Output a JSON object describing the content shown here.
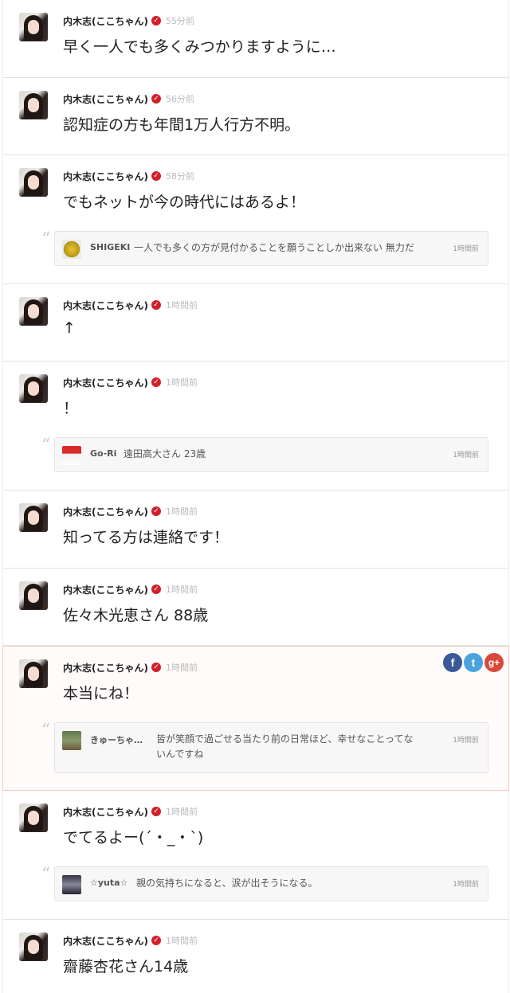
{
  "colors": {
    "accent": "#d21f2b",
    "highlight_border": "#f3c9c2",
    "facebook": "#3b5998",
    "twitter": "#4aa3df",
    "google": "#d8493b"
  },
  "posts": [
    {
      "name": "内木志(ここちゃん)",
      "time": "55分前",
      "text": "早く一人でも多くみつかりますように…"
    },
    {
      "name": "内木志(ここちゃん)",
      "time": "56分前",
      "text": "認知症の方も年間1万人行方不明。"
    },
    {
      "name": "内木志(ここちゃん)",
      "time": "58分前",
      "text": "でもネットが今の時代にはあるよ！",
      "quote": {
        "user": "SHIGEKI",
        "text": "一人でも多くの方が見付かることを願うことしか出来ない 無力だ",
        "time": "1時間前"
      }
    },
    {
      "name": "内木志(ここちゃん)",
      "time": "1時間前",
      "text": "↑"
    },
    {
      "name": "内木志(ここちゃん)",
      "time": "1時間前",
      "text": "！",
      "quote": {
        "user": "Go-Ri",
        "text": "遠田高大さん 23歳",
        "time": "1時間前"
      }
    },
    {
      "name": "内木志(ここちゃん)",
      "time": "1時間前",
      "text": "知ってる方は連絡です！"
    },
    {
      "name": "内木志(ここちゃん)",
      "time": "1時間前",
      "text": "佐々木光恵さん 88歳"
    },
    {
      "name": "内木志(ここちゃん)",
      "time": "1時間前",
      "text": "本当にね！",
      "share": {
        "facebook": "f",
        "twitter": "t",
        "google": "g+"
      },
      "quote": {
        "user": "きゅーちゃ…",
        "text": "皆が笑顔で過ごせる当たり前の日常ほど、幸せなことってないんですね",
        "text_line1": "皆が笑顔で過ごせる当たり前の日常ほど、幸せなことってな",
        "text_line2": "いんですね",
        "time": "1時間前"
      }
    },
    {
      "name": "内木志(ここちゃん)",
      "time": "1時間前",
      "text": "でてるよー(´・_・`)",
      "quote": {
        "user": "☆yuta☆",
        "text": "親の気持ちになると、涙が出そうになる。",
        "time": "1時間前"
      }
    },
    {
      "name": "内木志(ここちゃん)",
      "time": "1時間前",
      "text": "齋藤杏花さん14歳"
    }
  ]
}
